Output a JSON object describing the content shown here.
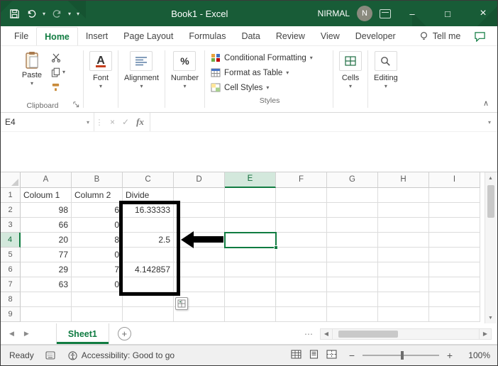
{
  "window": {
    "title": "Book1  -  Excel",
    "user": "NIRMAL",
    "avatar_initial": "N"
  },
  "tabs": {
    "items": [
      "File",
      "Home",
      "Insert",
      "Page Layout",
      "Formulas",
      "Data",
      "Review",
      "View",
      "Developer"
    ],
    "selected": "Home",
    "tell_me": "Tell me"
  },
  "ribbon": {
    "paste_label": "Paste",
    "clipboard_group_label": "Clipboard",
    "font_group_label": "Font",
    "alignment_group_label": "Alignment",
    "number_group_label": "Number",
    "styles_items": [
      "Conditional Formatting",
      "Format as Table",
      "Cell Styles"
    ],
    "styles_group_label": "Styles",
    "cells_group_label": "Cells",
    "editing_group_label": "Editing"
  },
  "formula_bar": {
    "name_box": "E4",
    "fx": "fx",
    "value": ""
  },
  "grid": {
    "columns": [
      "A",
      "B",
      "C",
      "D",
      "E",
      "F",
      "G",
      "H",
      "I"
    ],
    "rows": [
      "1",
      "2",
      "3",
      "4",
      "5",
      "6",
      "7",
      "8",
      "9"
    ],
    "cells": [
      [
        "Coloum 1",
        "Column 2",
        "Divide",
        "",
        "",
        "",
        "",
        "",
        ""
      ],
      [
        "98",
        "6",
        "16.33333",
        "",
        "",
        "",
        "",
        "",
        ""
      ],
      [
        "66",
        "0",
        "",
        "",
        "",
        "",
        "",
        "",
        ""
      ],
      [
        "20",
        "8",
        "2.5",
        "",
        "",
        "",
        "",
        "",
        ""
      ],
      [
        "77",
        "0",
        "",
        "",
        "",
        "",
        "",
        "",
        ""
      ],
      [
        "29",
        "7",
        "4.142857",
        "",
        "",
        "",
        "",
        "",
        ""
      ],
      [
        "63",
        "0",
        "",
        "",
        "",
        "",
        "",
        "",
        ""
      ],
      [
        "",
        "",
        "",
        "",
        "",
        "",
        "",
        "",
        ""
      ],
      [
        "",
        "",
        "",
        "",
        "",
        "",
        "",
        "",
        ""
      ]
    ],
    "selected": {
      "col": "E",
      "row": "4"
    }
  },
  "sheet_bar": {
    "active_sheet": "Sheet1"
  },
  "status_bar": {
    "ready": "Ready",
    "accessibility": "Accessibility: Good to go",
    "zoom": "100%"
  },
  "colors": {
    "accent_green": "#107C41",
    "titlebar_green": "#185C37"
  },
  "icons": {
    "caret_down": "▾",
    "collapse_ribbon": "∧",
    "minimize": "–",
    "maximize": "□",
    "close": "×",
    "cancel": "×",
    "enter": "✓",
    "dots_vertical": "⋮",
    "ellipsis": "⋯",
    "arrow_left": "◀",
    "arrow_right": "▶",
    "arrow_up": "▲",
    "arrow_down": "▼",
    "zoom_out": "−",
    "zoom_in": "+",
    "new_sheet": "+",
    "font_big": "A",
    "percent": "%"
  }
}
